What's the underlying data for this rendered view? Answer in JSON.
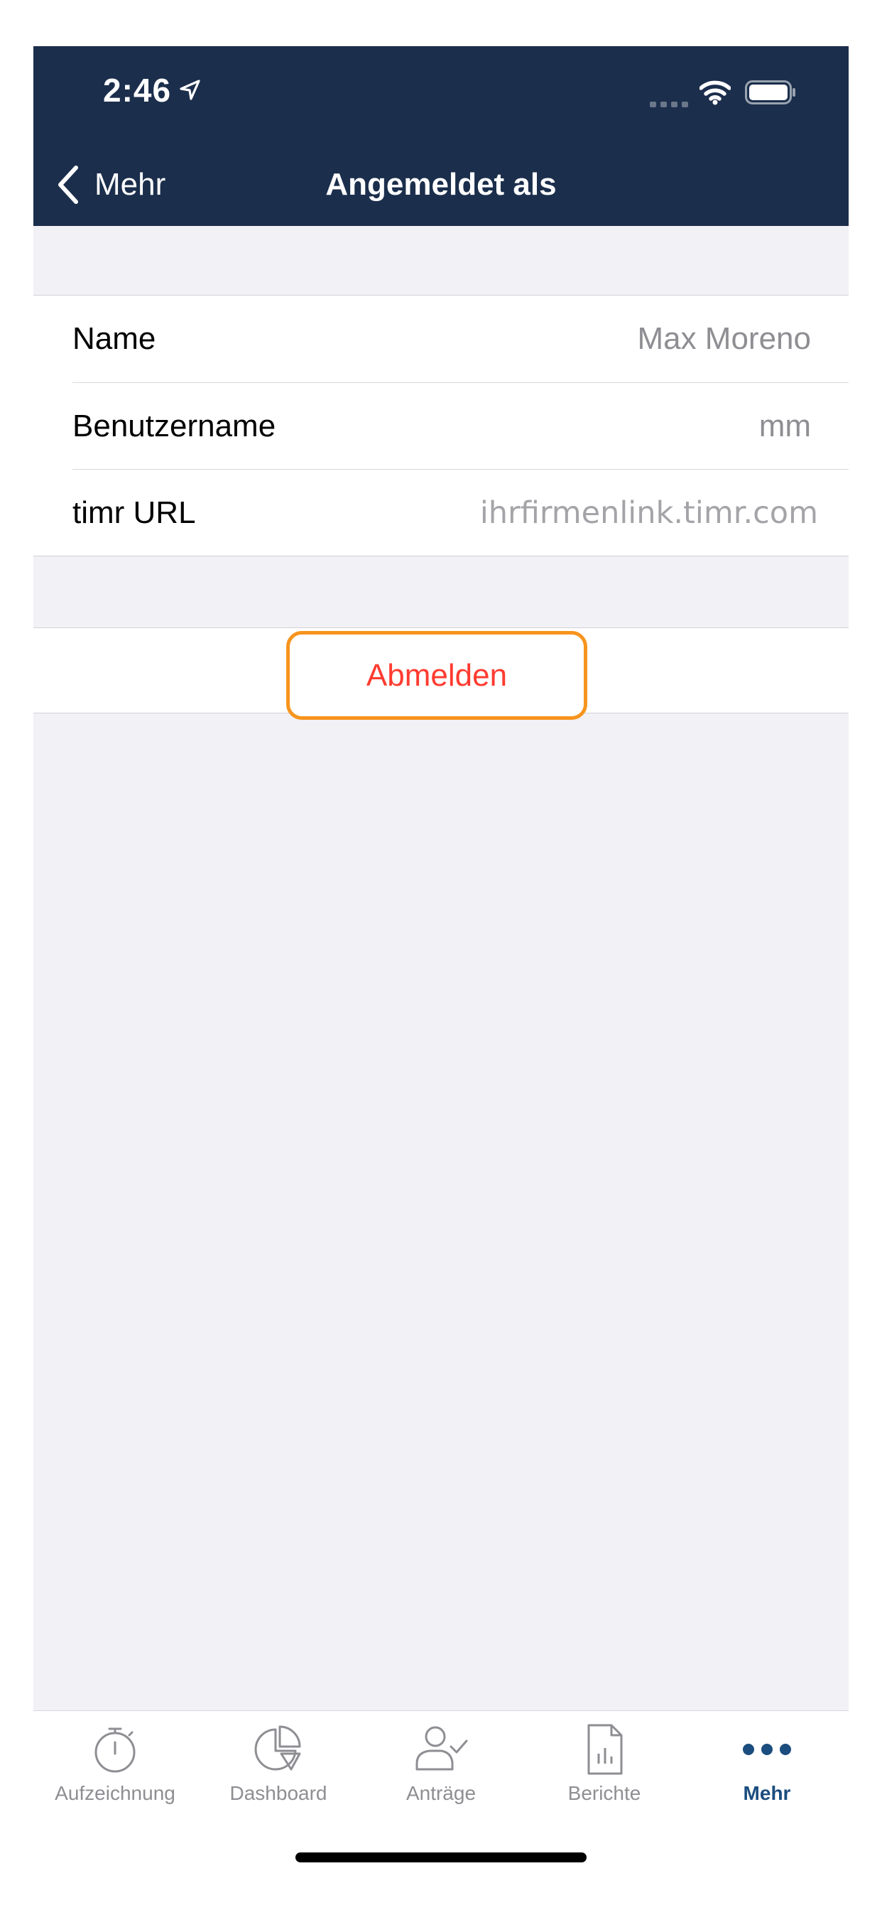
{
  "status_bar": {
    "time": "2:46",
    "icons": [
      "location-arrow-icon",
      "cellular-signal-icon",
      "wifi-icon",
      "battery-icon"
    ]
  },
  "nav": {
    "back_label": "Mehr",
    "title": "Angemeldet als"
  },
  "account": {
    "rows": [
      {
        "label": "Name",
        "value": "Max Moreno"
      },
      {
        "label": "Benutzername",
        "value": "mm"
      },
      {
        "label": "timr URL",
        "placeholder": "ihrfirmenlink.timr.com"
      }
    ]
  },
  "logout": {
    "label": "Abmelden",
    "highlight_color": "#f7941d",
    "text_color": "#ff3b30"
  },
  "tabs": [
    {
      "label": "Aufzeichnung",
      "icon": "stopwatch-icon",
      "active": false
    },
    {
      "label": "Dashboard",
      "icon": "pie-chart-icon",
      "active": false
    },
    {
      "label": "Anträge",
      "icon": "person-check-icon",
      "active": false
    },
    {
      "label": "Berichte",
      "icon": "report-document-icon",
      "active": false
    },
    {
      "label": "Mehr",
      "icon": "more-dots-icon",
      "active": true
    }
  ],
  "colors": {
    "header_bg": "#1b2e4c",
    "page_bg": "#f1f1f6",
    "active_tab": "#1b4d7e",
    "inactive_tab": "#8e8e93"
  }
}
